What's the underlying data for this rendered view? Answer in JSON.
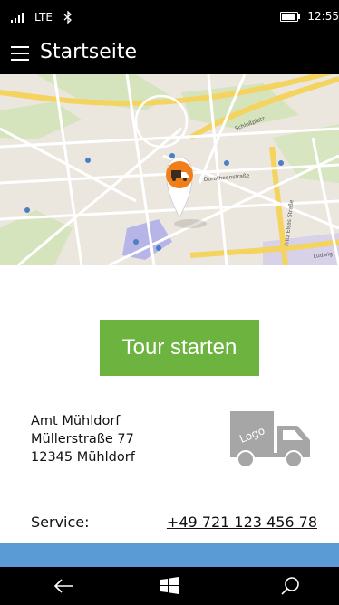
{
  "status": {
    "network": "LTE",
    "time": "12:55"
  },
  "header": {
    "menu_icon": "hamburger-icon",
    "title": "Startseite"
  },
  "map": {
    "marker_icon": "delivery-truck-icon",
    "marker_color": "#f07f1a",
    "labels": [
      "Schloßplatz",
      "Ludwig",
      "Fritz Elsas Straße",
      "Dorotheenstraße"
    ]
  },
  "actions": {
    "tour_start_label": "Tour starten",
    "button_color": "#6db33f"
  },
  "company": {
    "name": "Amt Mühldorf",
    "street": "Müllerstraße 77",
    "city": "12345 Mühldorf",
    "logo_icon": "truck-logo-icon",
    "logo_text": "Logo"
  },
  "service": {
    "label": "Service:",
    "phone": "+49 721 123 456 78"
  },
  "accent_color": "#5b9bd5",
  "navbar": {
    "back_icon": "back-arrow-icon",
    "home_icon": "windows-logo-icon",
    "search_icon": "search-icon"
  }
}
